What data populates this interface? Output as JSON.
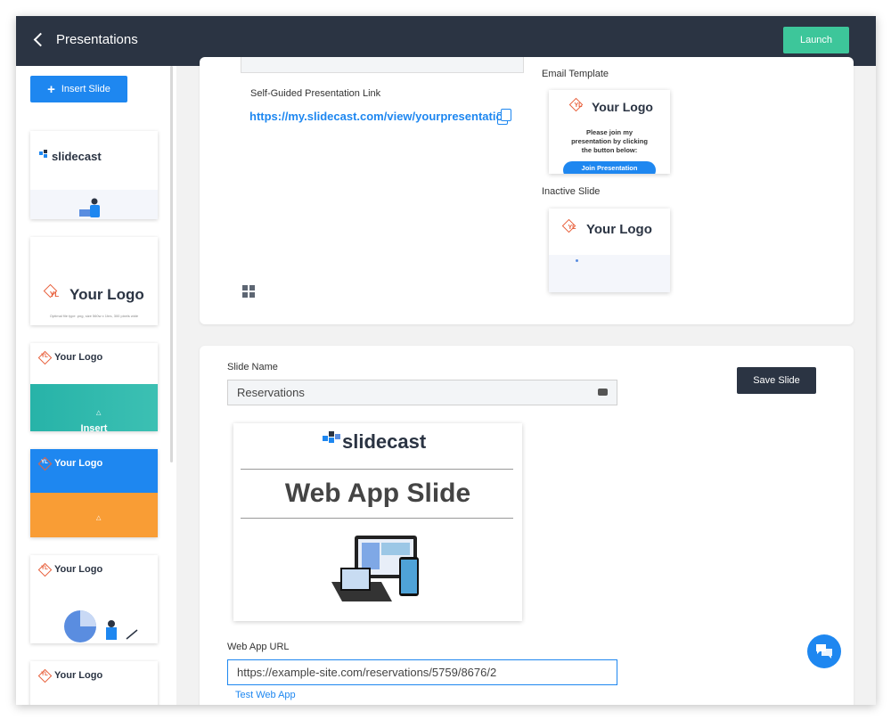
{
  "header": {
    "back_label": "Presentations",
    "launch_label": "Launch"
  },
  "sidebar": {
    "insert_label": "Insert Slide",
    "thumbs": [
      {
        "brand": "slidecast",
        "tag": ""
      },
      {
        "brand": "Your Logo",
        "sub": "Optimal file type .png, size 560w x 1hrs, 300 pixels wide"
      },
      {
        "brand": "Your Logo",
        "band": "teal",
        "band_text": "Insert"
      },
      {
        "brand": "Your Logo",
        "band": "blue-orange"
      },
      {
        "brand": "Your Logo",
        "band": "chart"
      },
      {
        "brand": "Your Logo",
        "band": "none"
      }
    ]
  },
  "card1": {
    "self_guided_label": "Self-Guided Presentation Link",
    "self_guided_url": "https://my.slidecast.com/view/yourpresentation",
    "email_template_label": "Email Template",
    "email_logo": "Your Logo",
    "email_text": "Please join my presentation by clicking the button below:",
    "email_button": "Join Presentation",
    "inactive_label": "Inactive Slide",
    "inactive_logo": "Your Logo"
  },
  "card2": {
    "slide_name_label": "Slide Name",
    "slide_name_value": "Reservations",
    "save_label": "Save Slide",
    "preview_brand": "slidecast",
    "preview_title": "Web App Slide",
    "url_label": "Web App URL",
    "url_value": "https://example-site.com/reservations/5759/8676/2",
    "test_label": "Test Web App"
  },
  "colors": {
    "topbar": "#2b3443",
    "accent": "#1e87f0",
    "launch": "#3dc69a",
    "logo": "#e8603c"
  }
}
